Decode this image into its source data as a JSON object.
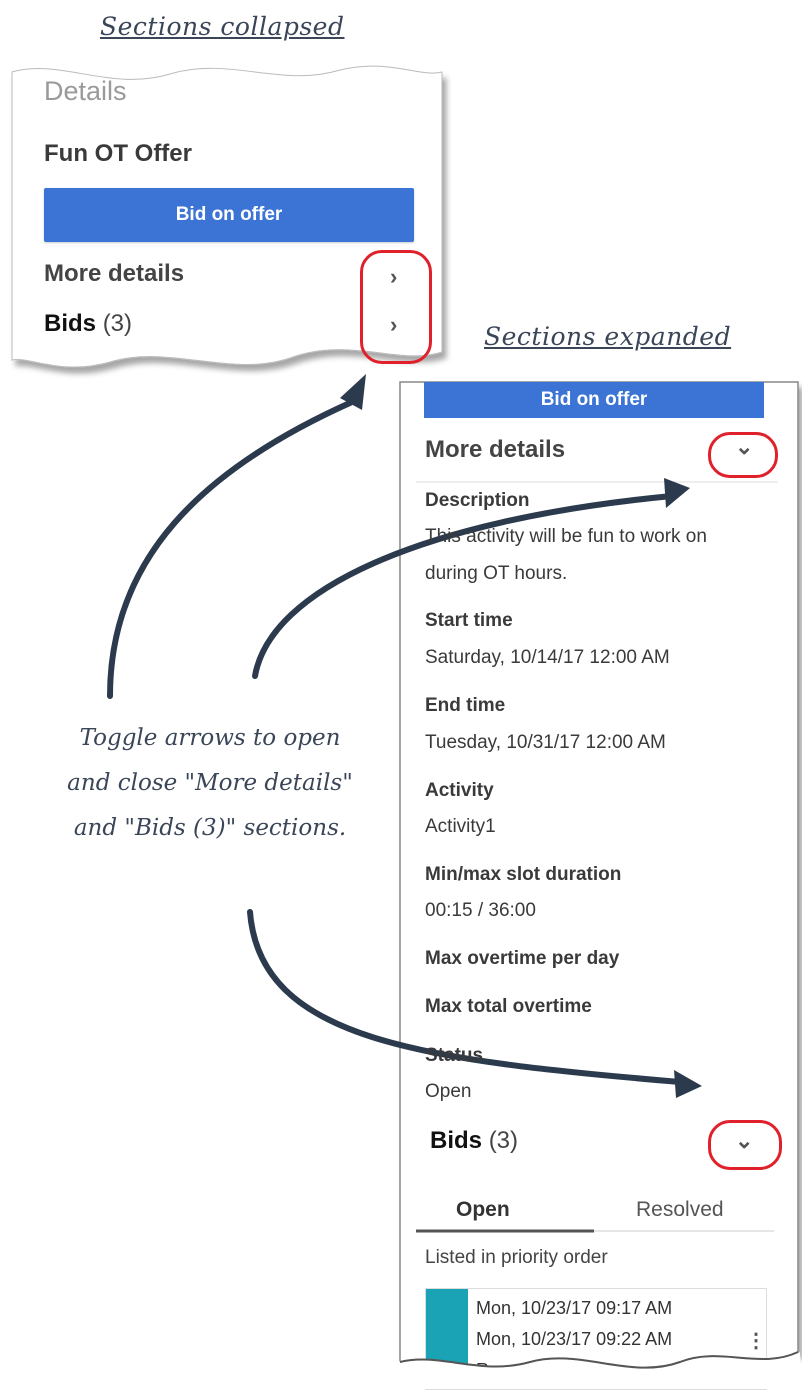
{
  "captions": {
    "collapsed": "Sections collapsed",
    "expanded": "Sections expanded"
  },
  "collapsed_panel": {
    "heading": "Details",
    "offer_title": "Fun OT Offer",
    "bid_button": "Bid on offer",
    "more_details": "More details",
    "bids_label": "Bids",
    "bids_count": "(3)",
    "chevron": "›"
  },
  "expanded_panel": {
    "bid_button": "Bid on offer",
    "more_details": "More details",
    "chevron": "⌄",
    "fields": [
      {
        "label": "Description",
        "value": "This activity will be fun to work on",
        "value2": "during OT hours."
      },
      {
        "label": "Start time",
        "value": "Saturday, 10/14/17 12:00 AM"
      },
      {
        "label": "End time",
        "value": "Tuesday, 10/31/17 12:00 AM"
      },
      {
        "label": "Activity",
        "value": "Activity1"
      },
      {
        "label": "Min/max slot duration",
        "value": "00:15 / 36:00"
      },
      {
        "label": "Max overtime per day"
      },
      {
        "label": "Max total overtime"
      },
      {
        "label": "Status",
        "value": "Open"
      }
    ],
    "bids_label": "Bids",
    "bids_count": "(3)",
    "tabs": [
      {
        "label": "Open",
        "active": true
      },
      {
        "label": "Resolved",
        "active": false
      }
    ],
    "listed_note": "Listed in priority order",
    "bid_item": {
      "line1": "Mon, 10/23/17 09:17 AM",
      "line2": "Mon, 10/23/17 09:22 AM",
      "line3": "Requested"
    },
    "kebab": "⋮"
  },
  "note": {
    "line1": "Toggle arrows to open",
    "line2": "and close \"More details\"",
    "line3": "and  \"Bids (3)\" sections."
  },
  "colors": {
    "accent": "#3c74d6",
    "highlight_ring": "#e0202a",
    "arrow": "#2c3a4d",
    "bid_swatch": "#1aa3b5"
  }
}
